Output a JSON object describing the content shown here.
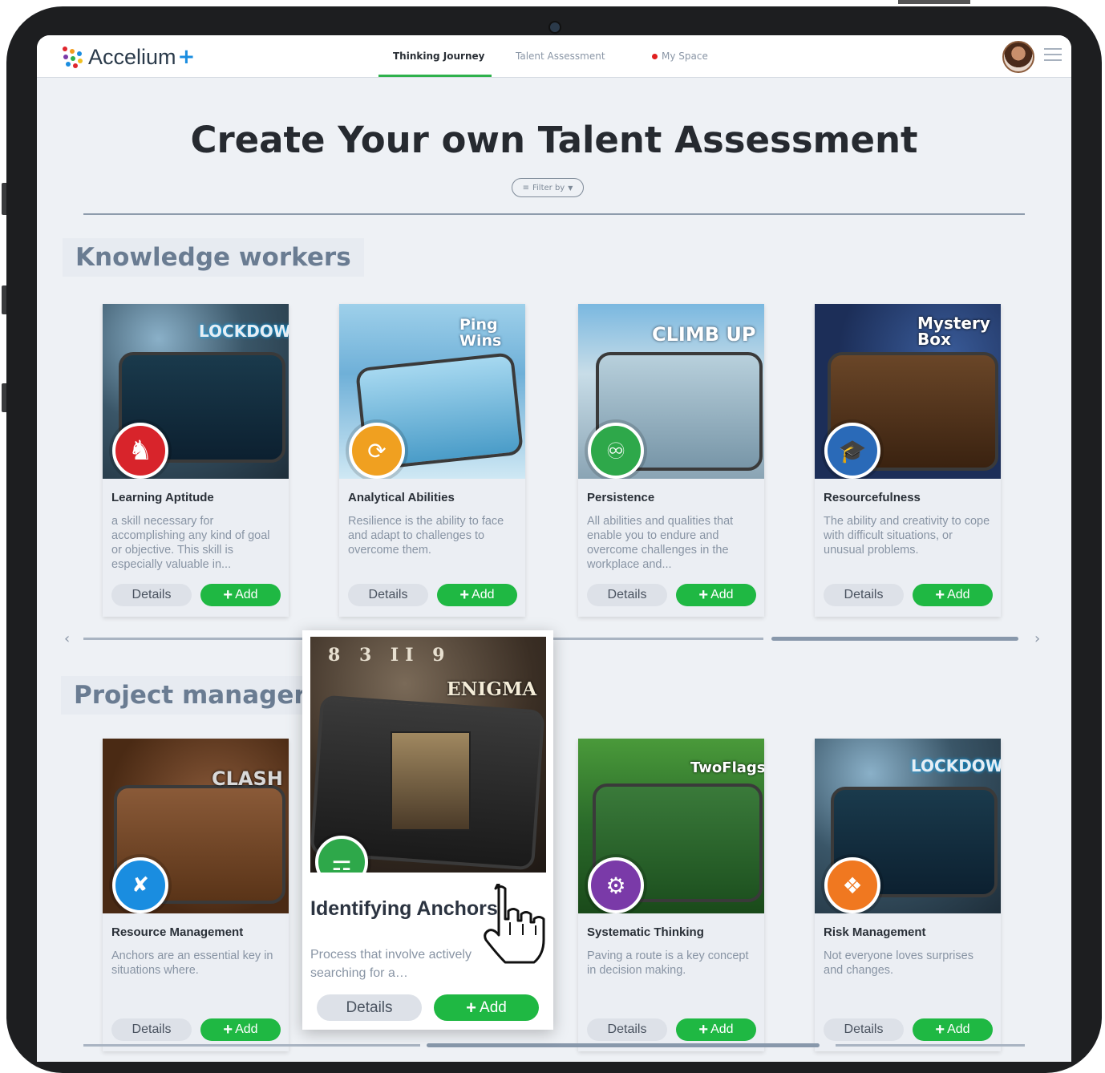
{
  "brand": {
    "name": "Accelium",
    "plus": "+"
  },
  "nav": {
    "thinking_journey": "Thinking Journey",
    "talent_assessment": "Talent Assessment",
    "my_space": "My Space"
  },
  "page": {
    "title": "Create Your own Talent Assessment",
    "filter_label": "Filter by"
  },
  "buttons": {
    "details": "Details",
    "add": "Add"
  },
  "sections": {
    "knowledge_workers": {
      "title": "Knowledge workers",
      "cards": [
        {
          "game": "LOCKDOWN",
          "title": "Learning Aptitude",
          "desc": "a skill necessary for accomplishing any kind of goal or objective. This skill is especially valuable in...",
          "badge_color": "#d8242b",
          "icon": "chess-knight-icon"
        },
        {
          "game": "Ping Wins",
          "title": "Analytical Abilities",
          "desc": "Resilience is the ability to face and adapt to challenges to overcome them.",
          "badge_color": "#f0a020",
          "icon": "people-cycle-icon"
        },
        {
          "game": "CLIMB UP",
          "title": "Persistence",
          "desc": "All abilities and qualities that enable you to endure and overcome challenges in the workplace and...",
          "badge_color": "#2ea84a",
          "icon": "person-push-icon"
        },
        {
          "game": "Mystery Box",
          "title": "Resourcefulness",
          "desc": "The ability and creativity to cope with difficult situations, or unusual problems.",
          "badge_color": "#2a6ab8",
          "icon": "graduation-cap-icon"
        }
      ]
    },
    "project_managers": {
      "title": "Project managers",
      "cards": [
        {
          "game": "CLASH",
          "title": "Resource Management",
          "desc": "Anchors are an essential key in situations where.",
          "badge_color": "#1a8de0",
          "icon": "strategy-icon"
        },
        {
          "game": "ENIGMA",
          "title": "Identifying Anchors",
          "desc": "Process that involve actively searching for a…",
          "badge_color": "#2ea84a",
          "icon": "tree-structure-icon"
        },
        {
          "game": "TwoFlags",
          "title": "Systematic Thinking",
          "desc": "Paving a route is a key concept in decision making.",
          "badge_color": "#7a3aa8",
          "icon": "gear-head-icon"
        },
        {
          "game": "LOCKDOWN",
          "title": "Risk Management",
          "desc": "Not everyone loves surprises and changes.",
          "badge_color": "#f07820",
          "icon": "puzzle-icon"
        }
      ]
    }
  }
}
